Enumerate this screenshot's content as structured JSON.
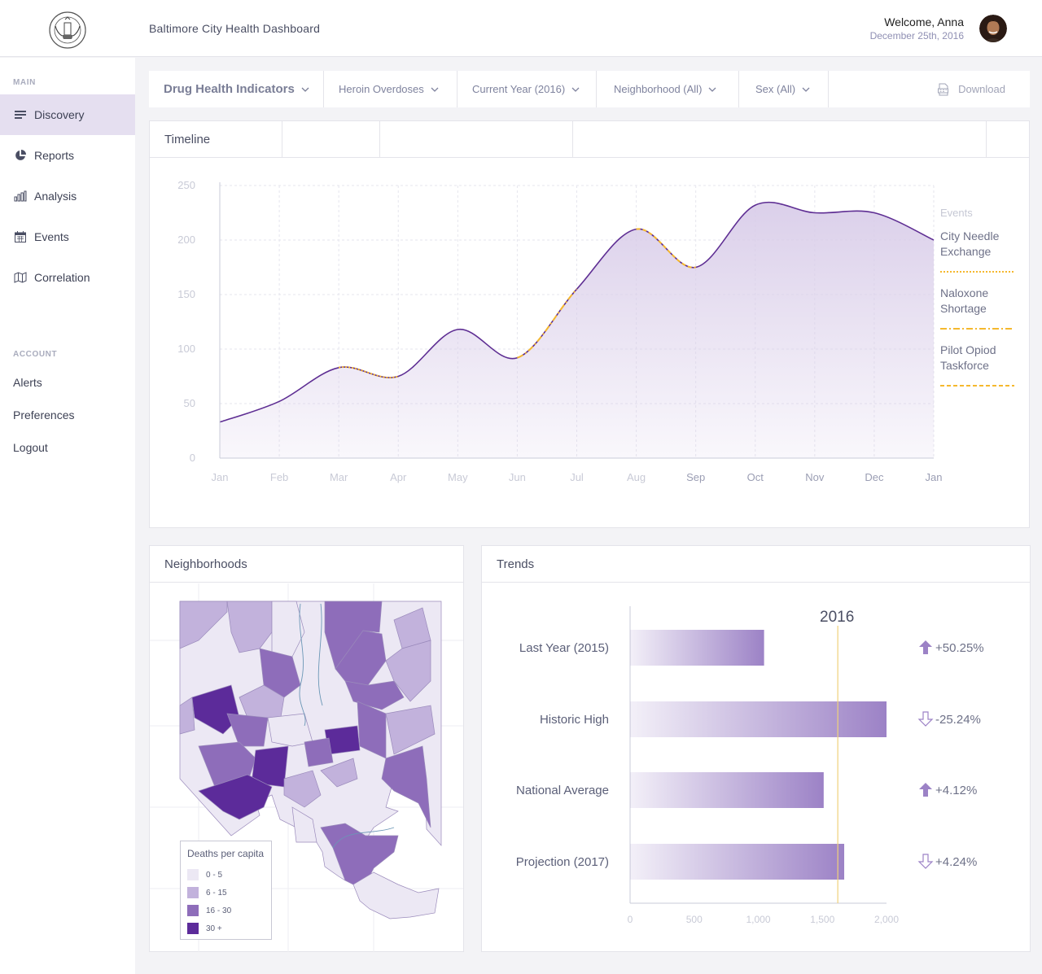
{
  "header": {
    "title": "Baltimore City Health Dashboard",
    "welcome": "Welcome, Anna",
    "date": "December 25th, 2016",
    "logo_icon": "health-department-seal-icon",
    "logo_text": "HEALTH DEPARTMENT · BALTIMORE MARYLAND"
  },
  "sidebar": {
    "main_heading": "MAIN",
    "items": [
      {
        "label": "Discovery",
        "icon": "list-icon",
        "active": true
      },
      {
        "label": "Reports",
        "icon": "pie-chart-icon"
      },
      {
        "label": "Analysis",
        "icon": "bar-chart-icon"
      },
      {
        "label": "Events",
        "icon": "calendar-icon"
      },
      {
        "label": "Correlation",
        "icon": "map-icon"
      }
    ],
    "account_heading": "ACCOUNT",
    "account_links": [
      "Alerts",
      "Preferences",
      "Logout"
    ]
  },
  "filters": {
    "title": "Drug Health Indicators",
    "indicator": "Heroin Overdoses",
    "period": "Current Year (2016)",
    "neighborhood": "Neighborhood (All)",
    "sex": "Sex (All)",
    "download": "Download"
  },
  "timeline": {
    "title": "Timeline",
    "events_heading": "Events",
    "events": [
      {
        "lines": [
          "City Needle",
          "Exchange"
        ],
        "style": "dotted"
      },
      {
        "lines": [
          "Naloxone",
          "Shortage"
        ],
        "style": "dash-dot"
      },
      {
        "lines": [
          "Pilot Opiod",
          "Taskforce"
        ],
        "style": "dashed"
      }
    ]
  },
  "neighborhoods": {
    "title": "Neighborhoods",
    "legend_title": "Deaths per capita",
    "legend": [
      {
        "label": "0 - 5",
        "color": "#ece8f4"
      },
      {
        "label": "6 - 15",
        "color": "#c2b2dc"
      },
      {
        "label": "16 - 30",
        "color": "#8e6dba"
      },
      {
        "label": "30 +",
        "color": "#5c2b9a"
      }
    ]
  },
  "trends": {
    "title": "Trends"
  },
  "chart_data": [
    {
      "type": "area",
      "title": "Timeline",
      "x": [
        "Jan",
        "Feb",
        "Mar",
        "Apr",
        "May",
        "Jun",
        "Jul",
        "Aug",
        "Sep",
        "Oct",
        "Nov",
        "Dec",
        "Jan"
      ],
      "y": [
        33,
        52,
        83,
        75,
        118,
        92,
        155,
        210,
        175,
        232,
        225,
        225,
        200
      ],
      "ylim": [
        0,
        250
      ],
      "yticks": [
        0,
        50,
        100,
        150,
        200,
        250
      ],
      "grid": true,
      "colors": {
        "line": "#5e2e93",
        "fill": "#d9cde9",
        "event": "#f5b82e"
      }
    },
    {
      "type": "bar",
      "orientation": "horizontal",
      "title": "Trends",
      "categories": [
        "Last Year (2015)",
        "Historic High",
        "National Average",
        "Projection (2017)"
      ],
      "values": [
        1045,
        2000,
        1510,
        1670
      ],
      "changes": [
        "+50.25%",
        "-25.24%",
        "+4.12%",
        "+4.24%"
      ],
      "directions": [
        "up",
        "down",
        "up",
        "down"
      ],
      "reference_label": "2016",
      "reference_value": 1620,
      "xlim": [
        0,
        2000
      ],
      "xticks": [
        "0",
        "500",
        "1,000",
        "1,500",
        "2,000"
      ],
      "colors": {
        "bar": "#9c82c6",
        "reference": "#f0d27a"
      }
    }
  ]
}
